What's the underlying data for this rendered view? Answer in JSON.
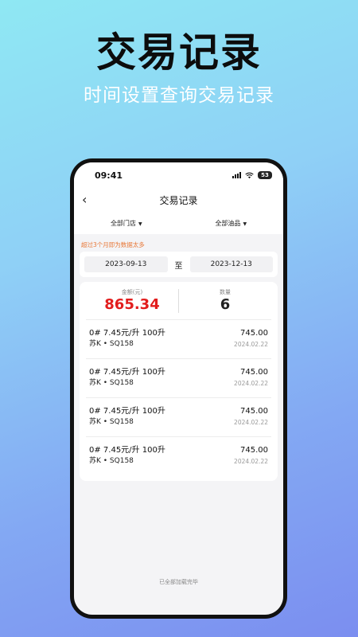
{
  "promo": {
    "title": "交易记录",
    "subtitle": "时间设置查询交易记录"
  },
  "status_bar": {
    "time": "09:41",
    "battery": "53"
  },
  "nav": {
    "back": "‹",
    "title": "交易记录"
  },
  "filters": {
    "store": "全部门店",
    "fuel": "全部油品",
    "caret": "▼"
  },
  "hint": "超过3个月即为数据太多",
  "date_range": {
    "start": "2023-09-13",
    "separator": "至",
    "end": "2023-12-13"
  },
  "summary": {
    "amount_label": "金额(元)",
    "amount": "865.34",
    "count_label": "数量",
    "count": "6"
  },
  "records": [
    {
      "fuel": "0# 7.45元/升 100升",
      "plate": "苏K • SQ158",
      "amount": "745.00",
      "date": "2024.02.22"
    },
    {
      "fuel": "0# 7.45元/升 100升",
      "plate": "苏K • SQ158",
      "amount": "745.00",
      "date": "2024.02.22"
    },
    {
      "fuel": "0# 7.45元/升 100升",
      "plate": "苏K • SQ158",
      "amount": "745.00",
      "date": "2024.02.22"
    },
    {
      "fuel": "0# 7.45元/升 100升",
      "plate": "苏K • SQ158",
      "amount": "745.00",
      "date": "2024.02.22"
    }
  ],
  "footer": "已全部加载完毕"
}
